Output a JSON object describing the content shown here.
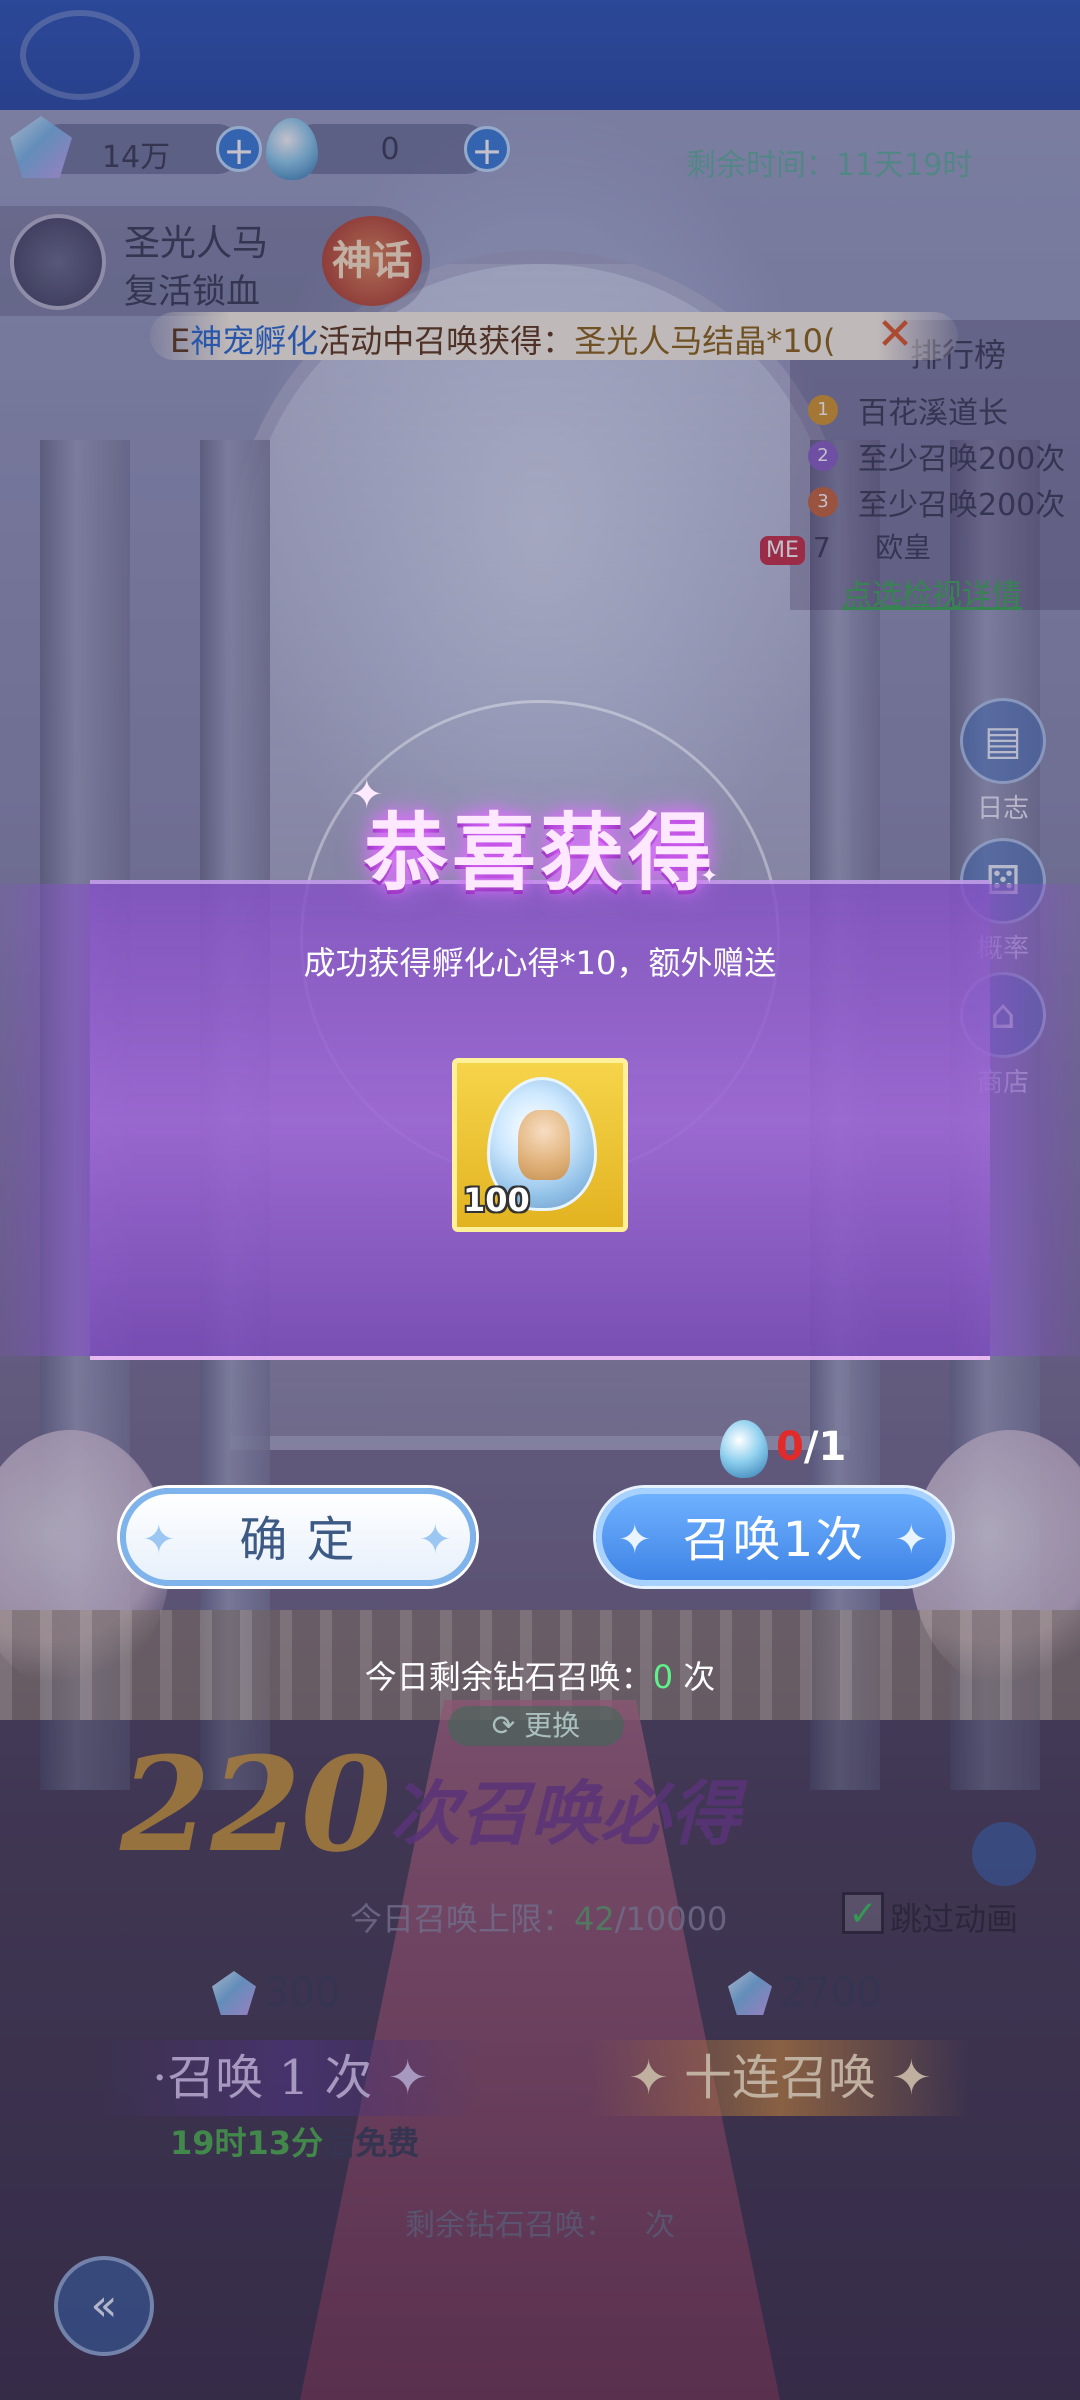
{
  "resources": {
    "diamonds": "14万",
    "eggs": "0",
    "remaining_time": "剩余时间：11天19时"
  },
  "pet": {
    "name": "圣光人马",
    "subtitle": "复活锁血",
    "rarity": "神话"
  },
  "marquee": {
    "prefix": "E",
    "event": "神宠孵化",
    "middle": "活动中召唤获得：",
    "reward": "圣光人马结晶*10("
  },
  "ranking": {
    "title": "排行榜",
    "entries": [
      {
        "rank": "1",
        "text": "百花溪道长"
      },
      {
        "rank": "2",
        "text": "至少召唤200次"
      },
      {
        "rank": "3",
        "text": "至少召唤200次"
      }
    ],
    "me_badge": "ME",
    "me_rank": "7",
    "me_name": "欧皇",
    "detail_link": "点选检视详情"
  },
  "side": {
    "log": "日志",
    "prob": "概率",
    "shop": "商店"
  },
  "modal": {
    "title": "恭喜获得",
    "message": "成功获得孵化心得*10，额外赠送",
    "reward_count": "100"
  },
  "actions": {
    "cost_current": "0",
    "cost_total": "/1",
    "confirm": "确 定",
    "summon_once": "召唤1次",
    "today_prefix": "今日剩余钻石召唤：",
    "today_count": "0",
    "today_suffix": " 次"
  },
  "lower": {
    "swap": "更换",
    "guarantee_num": "220",
    "guarantee_text": "次召唤必得",
    "limit_prefix": "今日召唤上限：",
    "limit_now": "42",
    "limit_total": "/10000",
    "skip_anim": "跳过动画",
    "price_single": "300",
    "price_ten": "2700",
    "btn_single": "·召唤 1 次 ✦",
    "btn_ten": "✦ 十连召唤 ✦",
    "free_time": "19时13分",
    "free_suffix": "后免费",
    "remain_prefix": "剩余钻石召唤：",
    "remain_suffix": "次"
  },
  "colors": {
    "accent_blue": "#3f84e6",
    "modal_purple": "#9e68d6",
    "reward_gold": "#f6d44a",
    "warning_red": "#e22a2a",
    "zero_green": "#5ff08b"
  }
}
